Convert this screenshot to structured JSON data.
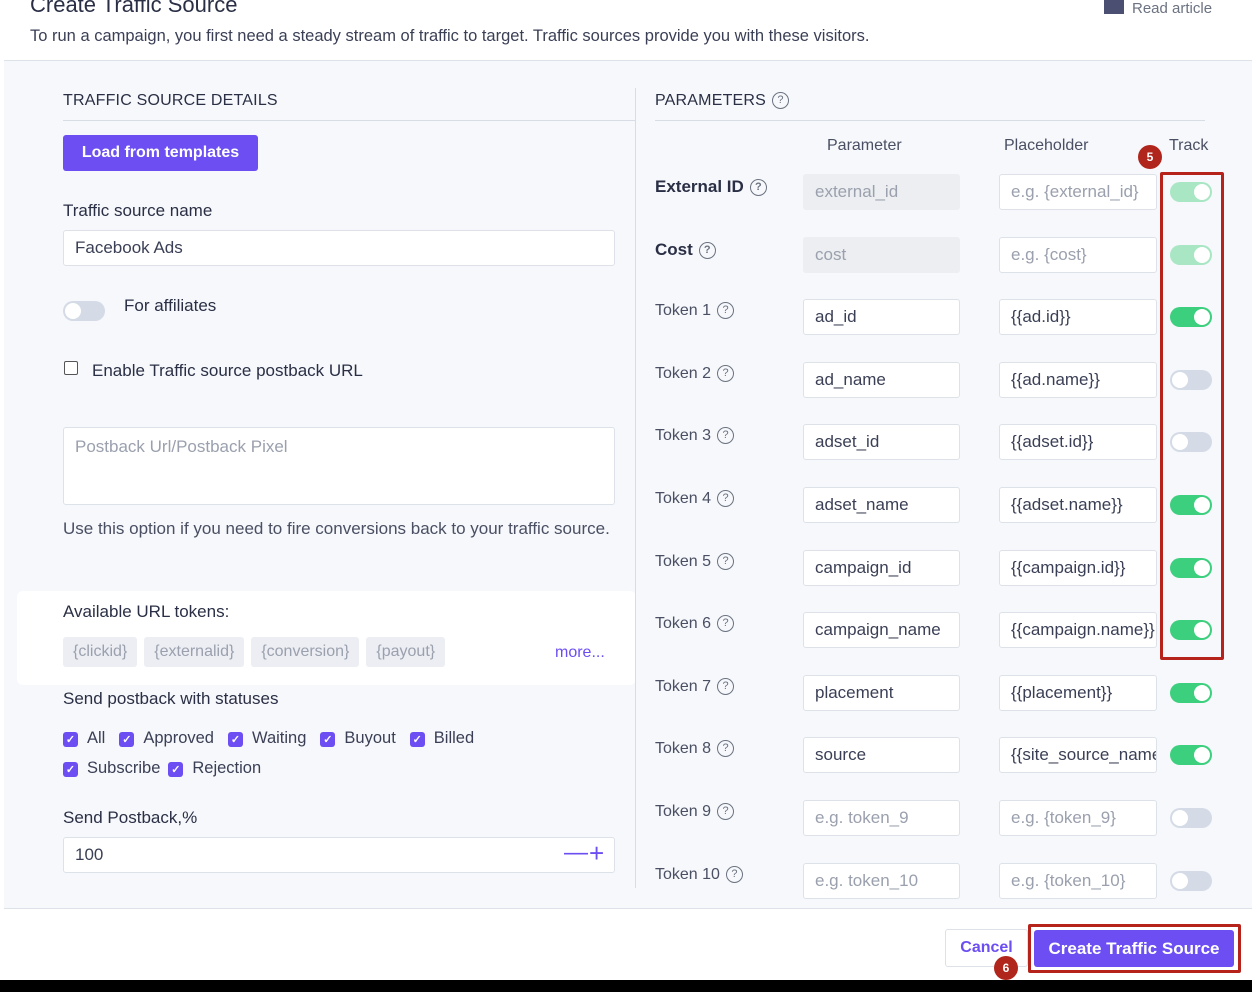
{
  "header": {
    "title": "Create Traffic Source",
    "read_article": "Read article",
    "subtitle": "To run a campaign, you first need a steady stream of traffic to target. Traffic sources provide you with these visitors."
  },
  "left": {
    "section_title": "TRAFFIC SOURCE DETAILS",
    "load_templates": "Load from templates",
    "name_label": "Traffic source name",
    "name_value": "Facebook Ads",
    "affiliates_label": "For affiliates",
    "affiliates_on": false,
    "postback_checkbox_label": "Enable Traffic source postback URL",
    "postback_checked": false,
    "postback_placeholder": "Postback Url/Postback Pixel",
    "postback_help": "Use this option if you need to fire conversions back to your traffic source.",
    "tokens_label": "Available URL tokens:",
    "tokens": [
      "{clickid}",
      "{externalid}",
      "{conversion}",
      "{payout}"
    ],
    "more": "more...",
    "statuses_label": "Send postback with statuses",
    "statuses": [
      "All",
      "Approved",
      "Waiting",
      "Buyout",
      "Billed",
      "Subscribe",
      "Rejection"
    ],
    "percent_label": "Send Postback,%",
    "percent_value": "100",
    "minus": "—",
    "plus": "+"
  },
  "right": {
    "section_title": "PARAMETERS",
    "col_parameter": "Parameter",
    "col_placeholder": "Placeholder",
    "col_track": "Track",
    "rows": [
      {
        "label": "External ID",
        "bold": true,
        "param": "external_id",
        "param_ph": true,
        "ph": "e.g. {external_id}",
        "ph_ph": true,
        "track": true,
        "disabled": true
      },
      {
        "label": "Cost",
        "bold": true,
        "param": "cost",
        "param_ph": true,
        "ph": "e.g. {cost}",
        "ph_ph": true,
        "track": true,
        "disabled": true
      },
      {
        "label": "Token 1",
        "param": "ad_id",
        "ph": "{{ad.id}}",
        "track": true
      },
      {
        "label": "Token 2",
        "param": "ad_name",
        "ph": "{{ad.name}}",
        "track": false
      },
      {
        "label": "Token 3",
        "param": "adset_id",
        "ph": "{{adset.id}}",
        "track": false
      },
      {
        "label": "Token 4",
        "param": "adset_name",
        "ph": "{{adset.name}}",
        "track": true
      },
      {
        "label": "Token 5",
        "param": "campaign_id",
        "ph": "{{campaign.id}}",
        "track": true
      },
      {
        "label": "Token 6",
        "param": "campaign_name",
        "ph": "{{campaign.name}}",
        "track": true
      },
      {
        "label": "Token 7",
        "param": "placement",
        "ph": "{{placement}}",
        "track": true
      },
      {
        "label": "Token 8",
        "param": "source",
        "ph": "{{site_source_name}}",
        "track": true
      },
      {
        "label": "Token 9",
        "param": "e.g. token_9",
        "param_ph": true,
        "ph": "e.g. {token_9}",
        "ph_ph": true,
        "track": false
      },
      {
        "label": "Token 10",
        "param": "e.g. token_10",
        "param_ph": true,
        "ph": "e.g. {token_10}",
        "ph_ph": true,
        "track": false
      }
    ]
  },
  "footer": {
    "cancel": "Cancel",
    "create": "Create Traffic Source"
  },
  "annotations": {
    "badge_track": "5",
    "badge_create": "6"
  },
  "colors": {
    "accent": "#6c4ef2",
    "toggle_on": "#3ccf7e",
    "annotation": "#b5231a"
  }
}
